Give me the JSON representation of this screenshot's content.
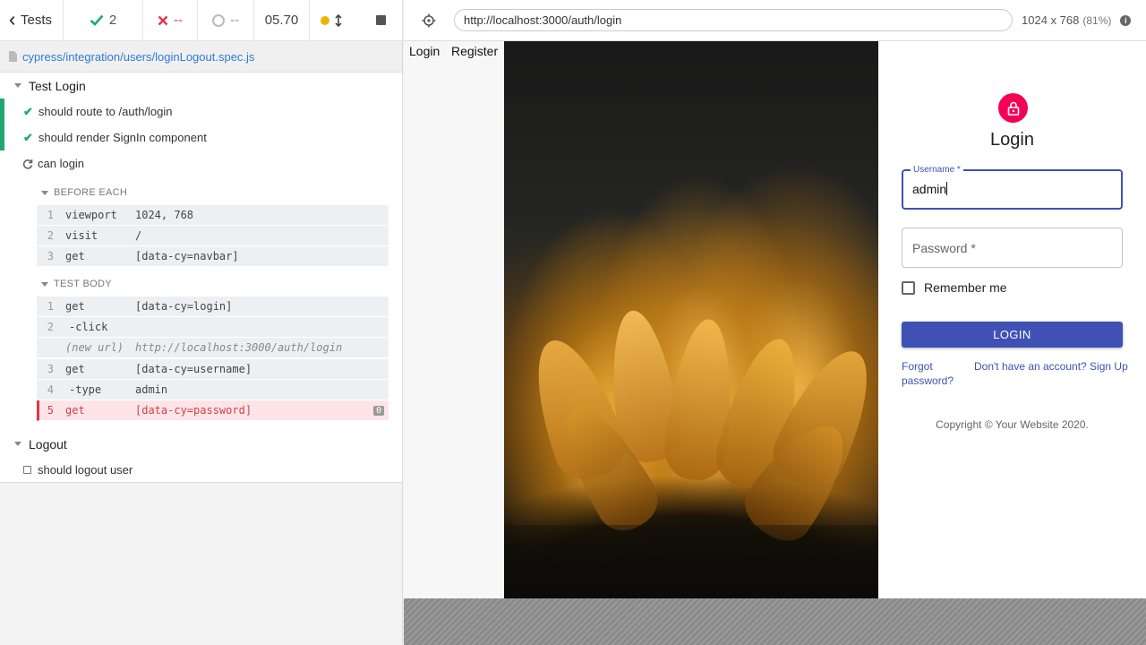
{
  "stats": {
    "tests_label": "Tests",
    "passed": "2",
    "failed": "--",
    "pending": "--",
    "duration": "05.70"
  },
  "spec": {
    "file": "cypress/integration/users/loginLogout.spec.js"
  },
  "suites": [
    {
      "title": "Test Login"
    },
    {
      "title": "Logout"
    }
  ],
  "tests": [
    {
      "title": "should route to /auth/login",
      "state": "passed"
    },
    {
      "title": "should render SignIn component",
      "state": "passed"
    },
    {
      "title": "can login",
      "state": "running"
    },
    {
      "title": "should logout user",
      "state": "pending"
    }
  ],
  "hooks": {
    "before_each": {
      "label": "BEFORE EACH",
      "commands": [
        {
          "num": "1",
          "name": "viewport",
          "msg": "1024, 768"
        },
        {
          "num": "2",
          "name": "visit",
          "msg": "/"
        },
        {
          "num": "3",
          "name": "get",
          "msg": "[data-cy=navbar]"
        }
      ]
    },
    "test_body": {
      "label": "TEST BODY",
      "commands": [
        {
          "num": "1",
          "name": "get",
          "msg": "[data-cy=login]"
        },
        {
          "num": "2",
          "name": "-click",
          "msg": ""
        },
        {
          "num": "",
          "name": "(new url)",
          "msg": "http://localhost:3000/auth/login"
        },
        {
          "num": "3",
          "name": "get",
          "msg": "[data-cy=username]"
        },
        {
          "num": "4",
          "name": "-type",
          "msg": "admin"
        },
        {
          "num": "5",
          "name": "get",
          "msg": "[data-cy=password]",
          "badge": "0"
        }
      ]
    }
  },
  "aut": {
    "url": "http://localhost:3000/auth/login",
    "viewport": "1024 x 768",
    "scale": "(81%)"
  },
  "app": {
    "nav": {
      "login": "Login",
      "register": "Register"
    },
    "form": {
      "title": "Login",
      "username_label": "Username *",
      "username_value": "admin",
      "password_placeholder": "Password *",
      "remember": "Remember me",
      "submit": "LOGIN",
      "forgot": "Forgot password?",
      "signup": "Don't have an account? Sign Up",
      "copyright": "Copyright © Your Website 2020."
    }
  },
  "colors": {
    "pass": "#1fa971",
    "fail": "#e0364a",
    "primary": "#3f51b5",
    "lock": "#f50057",
    "link": "#2e7bd6"
  }
}
